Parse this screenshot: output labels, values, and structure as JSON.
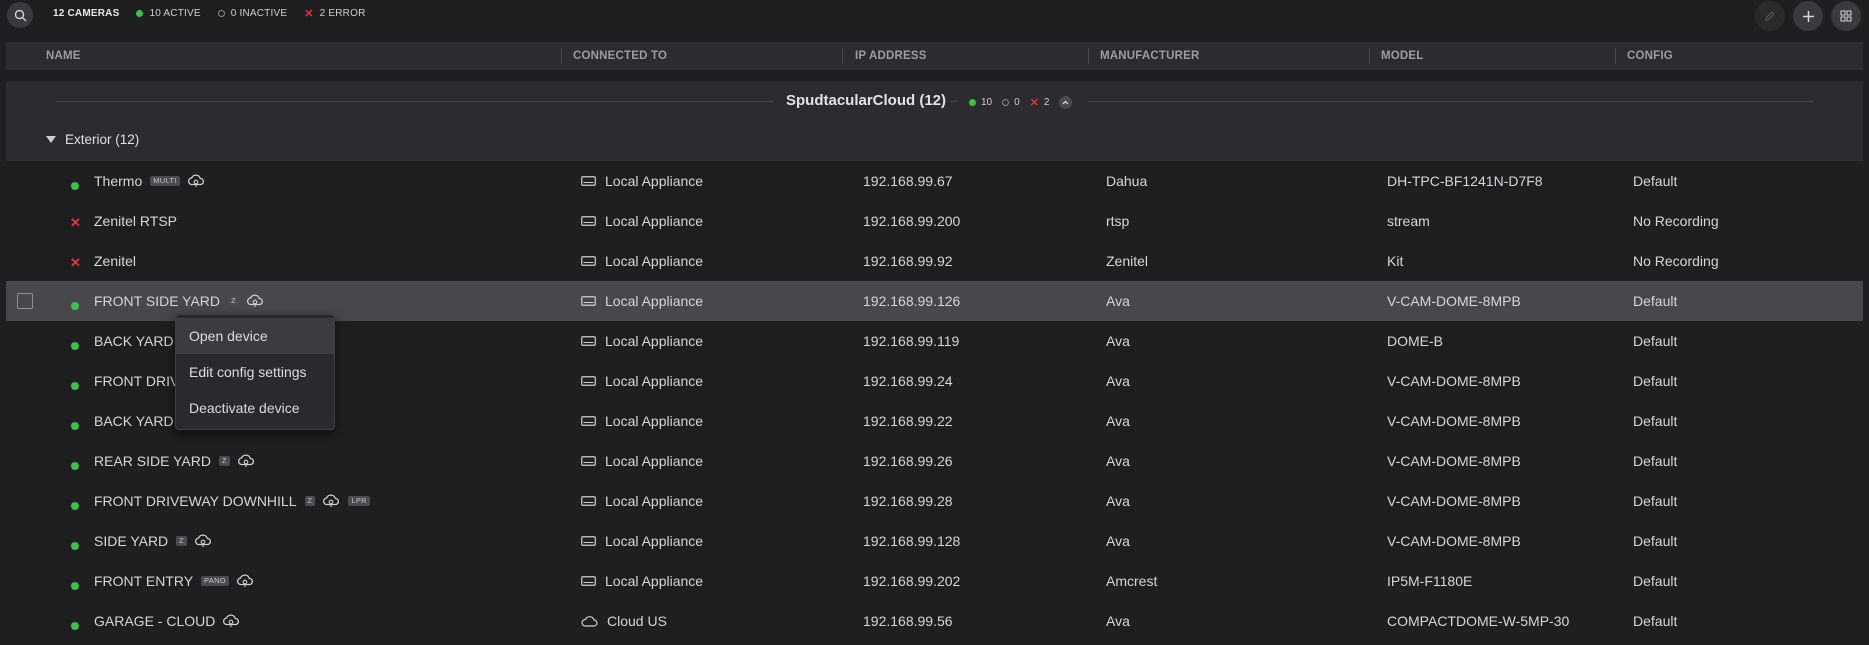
{
  "toolbar": {
    "total": "12 CAMERAS",
    "active": "10 ACTIVE",
    "inactive": "0 INACTIVE",
    "error": "2 ERROR",
    "icons": [
      "search-icon",
      "edit-icon",
      "plus-icon",
      "grid-icon"
    ]
  },
  "columns": [
    "NAME",
    "CONNECTED TO",
    "IP ADDRESS",
    "MANUFACTURER",
    "MODEL",
    "CONFIG"
  ],
  "group": {
    "title": "SpudtacularCloud (12)",
    "active": "10",
    "inactive": "0",
    "error": "2",
    "subgroup": "Exterior (12)"
  },
  "cameras": [
    {
      "name": "Thermo",
      "status": "active",
      "badges": [
        "MULTI"
      ],
      "cloud": true,
      "connected_to": "Local Appliance",
      "connection_type": "appliance",
      "ip": "192.168.99.67",
      "manufacturer": "Dahua",
      "model": "DH-TPC-BF1241N-D7F8",
      "config": "Default"
    },
    {
      "name": "Zenitel RTSP",
      "status": "error",
      "badges": [],
      "cloud": false,
      "connected_to": "Local Appliance",
      "connection_type": "appliance",
      "ip": "192.168.99.200",
      "manufacturer": "rtsp",
      "model": "stream",
      "config": "No Recording"
    },
    {
      "name": "Zenitel",
      "status": "error",
      "badges": [],
      "cloud": false,
      "connected_to": "Local Appliance",
      "connection_type": "appliance",
      "ip": "192.168.99.92",
      "manufacturer": "Zenitel",
      "model": "Kit",
      "config": "No Recording"
    },
    {
      "name": "FRONT SIDE YARD",
      "status": "active",
      "badges": [
        "Z"
      ],
      "cloud": true,
      "selected": true,
      "connected_to": "Local Appliance",
      "connection_type": "appliance",
      "ip": "192.168.99.126",
      "manufacturer": "Ava",
      "model": "V-CAM-DOME-8MPB",
      "config": "Default"
    },
    {
      "name": "BACK YARD",
      "status": "active",
      "badges": [],
      "cloud": false,
      "connected_to": "Local Appliance",
      "connection_type": "appliance",
      "ip": "192.168.99.119",
      "manufacturer": "Ava",
      "model": "DOME-B",
      "config": "Default"
    },
    {
      "name": "FRONT DRIV",
      "status": "active",
      "badges": [],
      "cloud": false,
      "connected_to": "Local Appliance",
      "connection_type": "appliance",
      "ip": "192.168.99.24",
      "manufacturer": "Ava",
      "model": "V-CAM-DOME-8MPB",
      "config": "Default"
    },
    {
      "name": "BACK YARD I",
      "status": "active",
      "badges": [],
      "cloud": false,
      "connected_to": "Local Appliance",
      "connection_type": "appliance",
      "ip": "192.168.99.22",
      "manufacturer": "Ava",
      "model": "V-CAM-DOME-8MPB",
      "config": "Default"
    },
    {
      "name": "REAR SIDE YARD",
      "status": "active",
      "badges": [
        "Z"
      ],
      "cloud": true,
      "connected_to": "Local Appliance",
      "connection_type": "appliance",
      "ip": "192.168.99.26",
      "manufacturer": "Ava",
      "model": "V-CAM-DOME-8MPB",
      "config": "Default"
    },
    {
      "name": "FRONT DRIVEWAY DOWNHILL",
      "status": "active",
      "badges": [
        "Z"
      ],
      "cloud": true,
      "extra_badge": "LPR",
      "connected_to": "Local Appliance",
      "connection_type": "appliance",
      "ip": "192.168.99.28",
      "manufacturer": "Ava",
      "model": "V-CAM-DOME-8MPB",
      "config": "Default"
    },
    {
      "name": "SIDE YARD",
      "status": "active",
      "badges": [
        "Z"
      ],
      "cloud": true,
      "connected_to": "Local Appliance",
      "connection_type": "appliance",
      "ip": "192.168.99.128",
      "manufacturer": "Ava",
      "model": "V-CAM-DOME-8MPB",
      "config": "Default"
    },
    {
      "name": "FRONT ENTRY",
      "status": "active",
      "badges": [
        "PANO"
      ],
      "cloud": true,
      "connected_to": "Local Appliance",
      "connection_type": "appliance",
      "ip": "192.168.99.202",
      "manufacturer": "Amcrest",
      "model": "IP5M-F1180E",
      "config": "Default"
    },
    {
      "name": "GARAGE - CLOUD",
      "status": "active",
      "badges": [],
      "cloud": true,
      "connected_to": "Cloud US",
      "connection_type": "cloud",
      "ip": "192.168.99.56",
      "manufacturer": "Ava",
      "model": "COMPACTDOME-W-5MP-30",
      "config": "Default"
    }
  ],
  "context_menu": {
    "items": [
      "Open device",
      "Edit config settings",
      "Deactivate device"
    ],
    "hovered": "Open device"
  },
  "colors": {
    "active": "#3fbf4a",
    "error": "#e0323c",
    "background": "#1f1f22",
    "selected_row": "#48484c"
  }
}
